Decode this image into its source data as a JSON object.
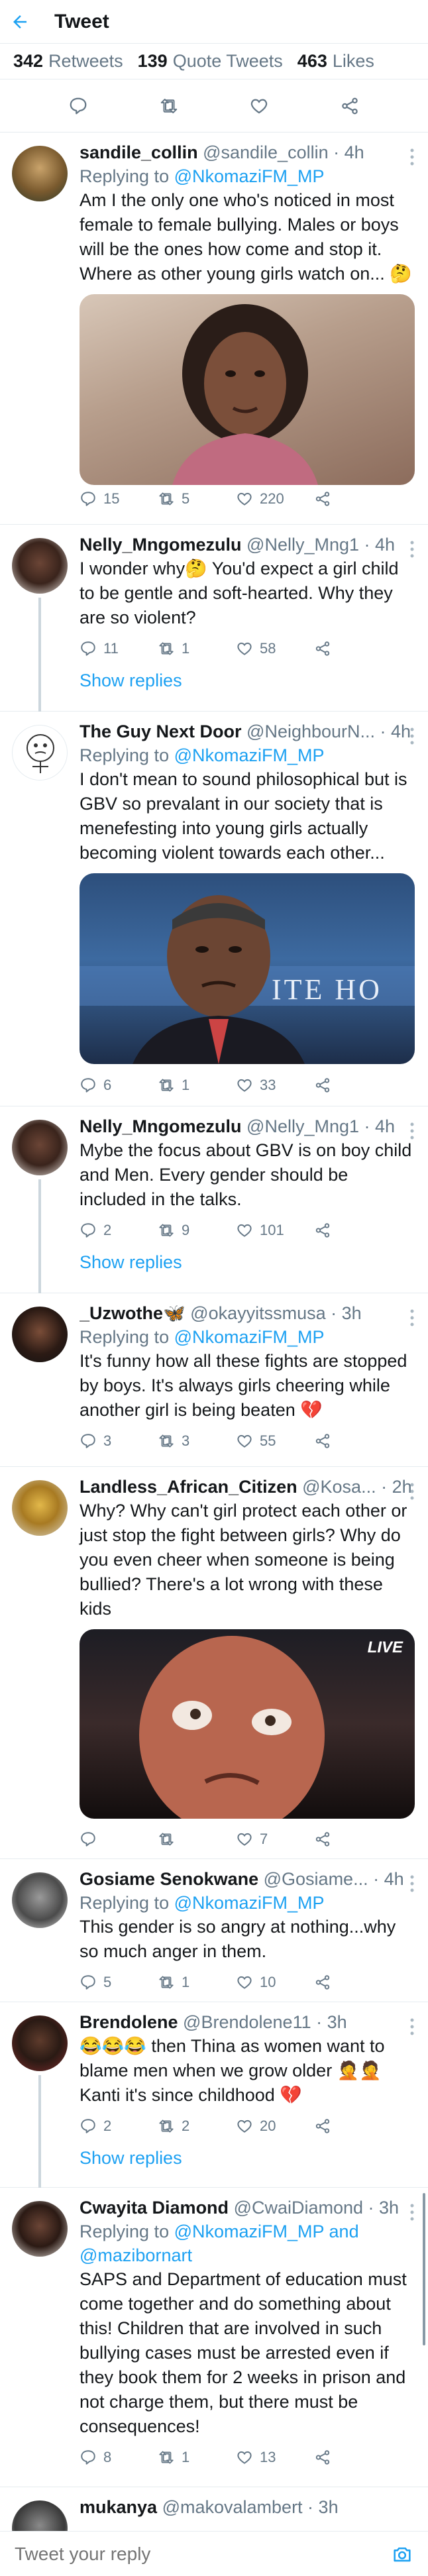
{
  "header": {
    "title": "Tweet"
  },
  "stats": {
    "retweets_count": "342",
    "retweets_label": "Retweets",
    "quotes_count": "139",
    "quotes_label": "Quote Tweets",
    "likes_count": "463",
    "likes_label": "Likes"
  },
  "colors": {
    "accent": "#1da1f2",
    "muted": "#657786",
    "text": "#14171a",
    "like_red": "#e0245e"
  },
  "tweets": [
    {
      "name": "sandile_collin",
      "meta": "@sandile_collin · 4h",
      "reply_prefix": "Replying to ",
      "reply_to": "@NkomaziFM_MP",
      "text": "Am I the only one who's noticed in most female to female bullying. Males or boys will be the ones how come and stop it. Where as other young girls watch on... 🤔",
      "replies": "15",
      "retweets": "5",
      "likes": "220"
    },
    {
      "name": "Nelly_Mngomezulu",
      "meta": "@Nelly_Mng1 · 4h",
      "text": "I wonder why🤔 You'd expect a girl child to be gentle and soft-hearted. Why they are so violent?",
      "replies": "11",
      "retweets": "1",
      "likes": "58",
      "show_replies": "Show replies"
    },
    {
      "name": "The Guy Next Door",
      "meta": "@NeighbourN... · 4h",
      "reply_prefix": "Replying to ",
      "reply_to": "@NkomaziFM_MP",
      "text": "I don't mean to sound philosophical but is GBV so prevalant in our society that is menefesting into young girls actually becoming violent towards each other...",
      "media_text": "ITE HO",
      "replies": "6",
      "retweets": "1",
      "likes": "33"
    },
    {
      "name": "Nelly_Mngomezulu",
      "meta": "@Nelly_Mng1 · 4h",
      "text": "Mybe the focus about GBV is on boy child and Men. Every gender should be included in the talks.",
      "replies": "2",
      "retweets": "9",
      "likes": "101",
      "show_replies": "Show replies"
    },
    {
      "name": "_Uzwothe🦋",
      "meta": "@okayyitssmusa · 3h",
      "reply_prefix": "Replying to ",
      "reply_to": "@NkomaziFM_MP",
      "text": "It's funny how all these fights are stopped by boys. It's always girls cheering while another girl is being beaten 💔",
      "replies": "3",
      "retweets": "3",
      "likes": "55"
    },
    {
      "name": "Landless_African_Citizen",
      "meta": "@Kosa... · 2h",
      "text": "Why? Why can't girl protect each other or just stop the fight between girls? Why do you even cheer when someone is being bullied? There's a lot wrong with these kids",
      "media_text": "LIVE",
      "replies": "",
      "retweets": "",
      "likes": "7"
    },
    {
      "name": "Gosiame Senokwane",
      "meta": "@Gosiame... · 4h",
      "reply_prefix": "Replying to ",
      "reply_to": "@NkomaziFM_MP",
      "text": "This gender is so angry at nothing...why so much anger in them.",
      "replies": "5",
      "retweets": "1",
      "likes": "10"
    },
    {
      "name": "Brendolene",
      "meta": "@Brendolene11 · 3h",
      "text": "😂😂😂 then Thina as women want to blame men when we grow older 🤦🤦 Kanti it's since childhood 💔",
      "replies": "2",
      "retweets": "2",
      "likes": "20",
      "show_replies": "Show replies"
    },
    {
      "name": "Cwayita Diamond",
      "meta": "@CwaiDiamond · 3h",
      "reply_prefix": "Replying to ",
      "reply_to": "@NkomaziFM_MP and @mazibornart",
      "text": "SAPS and Department of education must come together and do something about this! Children that are involved in such bullying cases must be arrested even if they book them for 2 weeks in prison and not charge them, but there must be consequences!",
      "replies": "8",
      "retweets": "1",
      "likes": "13"
    },
    {
      "name": "mukanya",
      "meta": "@makovalambert · 3h"
    }
  ],
  "reply_bar": {
    "placeholder": "Tweet your reply"
  }
}
